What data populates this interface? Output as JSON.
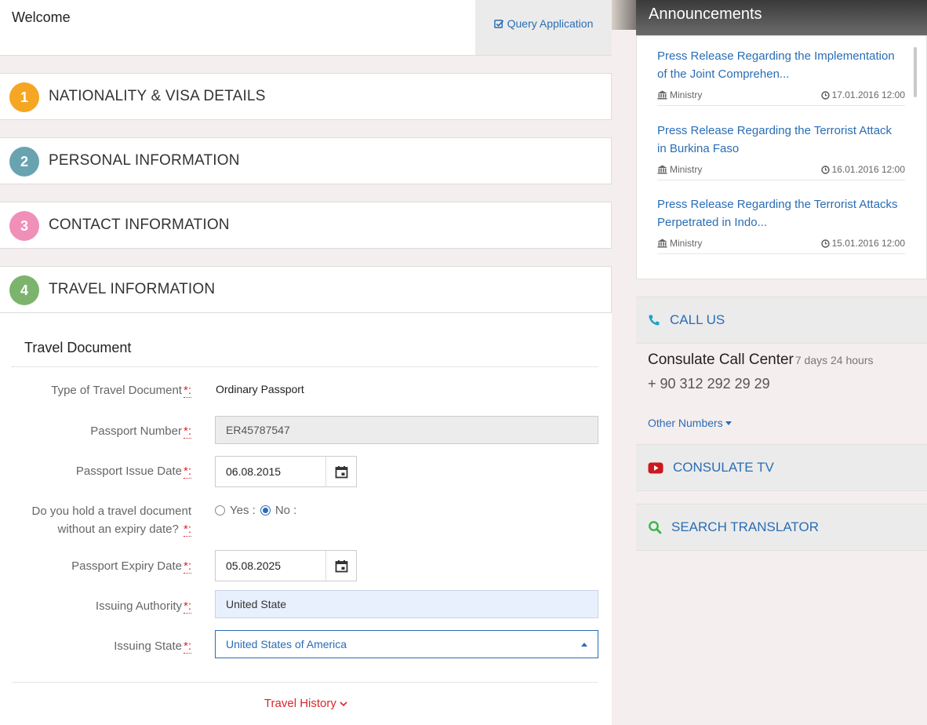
{
  "header": {
    "welcome": "Welcome",
    "query_application": "Query Application"
  },
  "steps": [
    {
      "num": "1",
      "title": "NATIONALITY & VISA DETAILS",
      "color": "#f5a623"
    },
    {
      "num": "2",
      "title": "PERSONAL INFORMATION",
      "color": "#6aa3b0"
    },
    {
      "num": "3",
      "title": "CONTACT INFORMATION",
      "color": "#f08fb8"
    },
    {
      "num": "4",
      "title": "TRAVEL INFORMATION",
      "color": "#7cb46e"
    }
  ],
  "travel_document": {
    "section_title": "Travel Document",
    "required_mark": "*:",
    "type_label": "Type of Travel Document",
    "type_value": "Ordinary Passport",
    "passport_number_label": "Passport Number",
    "passport_number_value": "ER45787547",
    "issue_date_label": "Passport Issue Date",
    "issue_date_value": "06.08.2015",
    "no_expiry_label_line1": "Do you hold a travel document",
    "no_expiry_label_line2": "without an expiry date?",
    "radio_yes": "Yes :",
    "radio_no": "No :",
    "selected_option": "No",
    "expiry_date_label": "Passport Expiry Date",
    "expiry_date_value": "05.08.2025",
    "issuing_authority_label": "Issuing Authority",
    "issuing_authority_value": "United State",
    "issuing_state_label": "Issuing State",
    "issuing_state_value": "United States of America",
    "travel_history": "Travel History"
  },
  "announcements": {
    "title": "Announcements",
    "items": [
      {
        "title_line1": "Press Release Regarding the Implementation",
        "title_line2": "of the Joint Comprehen...",
        "source": "Ministry",
        "date": "17.01.2016 12:00"
      },
      {
        "title_line1": "Press Release Regarding the Terrorist Attack",
        "title_line2": "in Burkina Faso",
        "source": "Ministry",
        "date": "16.01.2016 12:00"
      },
      {
        "title_line1": "Press Release Regarding the Terrorist Attacks",
        "title_line2": "Perpetrated in Indo...",
        "source": "Ministry",
        "date": "15.01.2016 12:00"
      }
    ]
  },
  "call_us": {
    "label": "CALL US",
    "center_title": "Consulate Call Center",
    "hours": "7 days 24 hours",
    "number": "+ 90 312 292 29 29",
    "other_numbers": "Other Numbers"
  },
  "consulate_tv": {
    "label": "CONSULATE TV"
  },
  "search_translator": {
    "label": "SEARCH TRANSLATOR"
  },
  "colors": {
    "link": "#2a6db5",
    "required": "#d9262c",
    "youtube": "#cc181e",
    "phone": "#1aa3c8",
    "search": "#3cb44b"
  }
}
